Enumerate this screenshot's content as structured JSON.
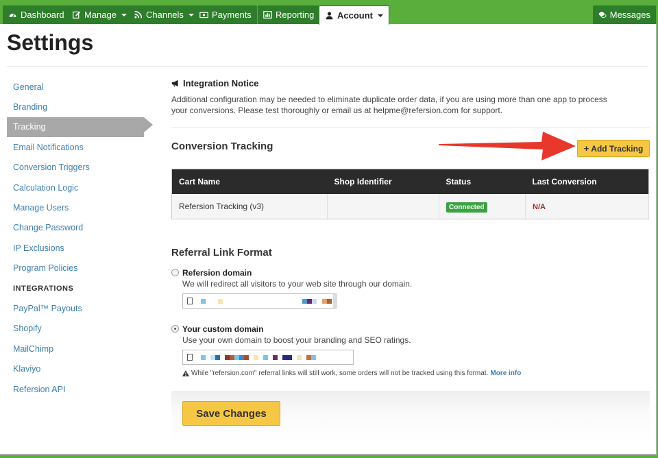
{
  "nav": {
    "tabs": [
      {
        "label": "Dashboard",
        "icon": "dashboard-icon"
      },
      {
        "label": "Manage",
        "icon": "edit-icon"
      },
      {
        "label": "Channels",
        "icon": "rss-icon"
      },
      {
        "label": "Payments",
        "icon": "money-icon"
      },
      {
        "label": "Reporting",
        "icon": "chart-icon"
      },
      {
        "label": "Account",
        "icon": "user-icon"
      }
    ],
    "messages": "Messages"
  },
  "page_title": "Settings",
  "sidebar": {
    "items": [
      "General",
      "Branding",
      "Tracking",
      "Email Notifications",
      "Conversion Triggers",
      "Calculation Logic",
      "Manage Users",
      "Change Password",
      "IP Exclusions",
      "Program Policies"
    ],
    "heading": "INTEGRATIONS",
    "integrations": [
      "PayPal™ Payouts",
      "Shopify",
      "MailChimp",
      "Klaviyo",
      "Refersion API"
    ]
  },
  "notice": {
    "title": "Integration Notice",
    "body": "Additional configuration may be needed to eliminate duplicate order data, if you are using more than one app to process your conversions. Please test thoroughly or email us at helpme@refersion.com for support."
  },
  "conversion": {
    "title": "Conversion Tracking",
    "add_button": "Add Tracking",
    "columns": [
      "Cart Name",
      "Shop Identifier",
      "Status",
      "Last Conversion"
    ],
    "row": {
      "cart": "Refersion Tracking (v3)",
      "shop": "",
      "status": "Connected",
      "last": "N/A"
    }
  },
  "referral": {
    "title": "Referral Link Format",
    "option1_label": "Refersion domain",
    "option1_desc": "We will redirect all visitors to your web site through our domain.",
    "option2_label": "Your custom domain",
    "option2_desc": "Use your own domain to boost your branding and SEO ratings.",
    "warning": "While \"refersion.com\" referral links will still work, some orders will not be tracked using this format.",
    "more_info": "More info",
    "selected": "Your custom domain"
  },
  "save_button": "Save Changes",
  "colors": {
    "brand_green": "#5aaf3c",
    "dark_green": "#2e7d2a",
    "button_yellow": "#f6c744",
    "link_blue": "#3b7fb0",
    "connected_green": "#3aa243",
    "arrow_red": "#e8382c"
  }
}
